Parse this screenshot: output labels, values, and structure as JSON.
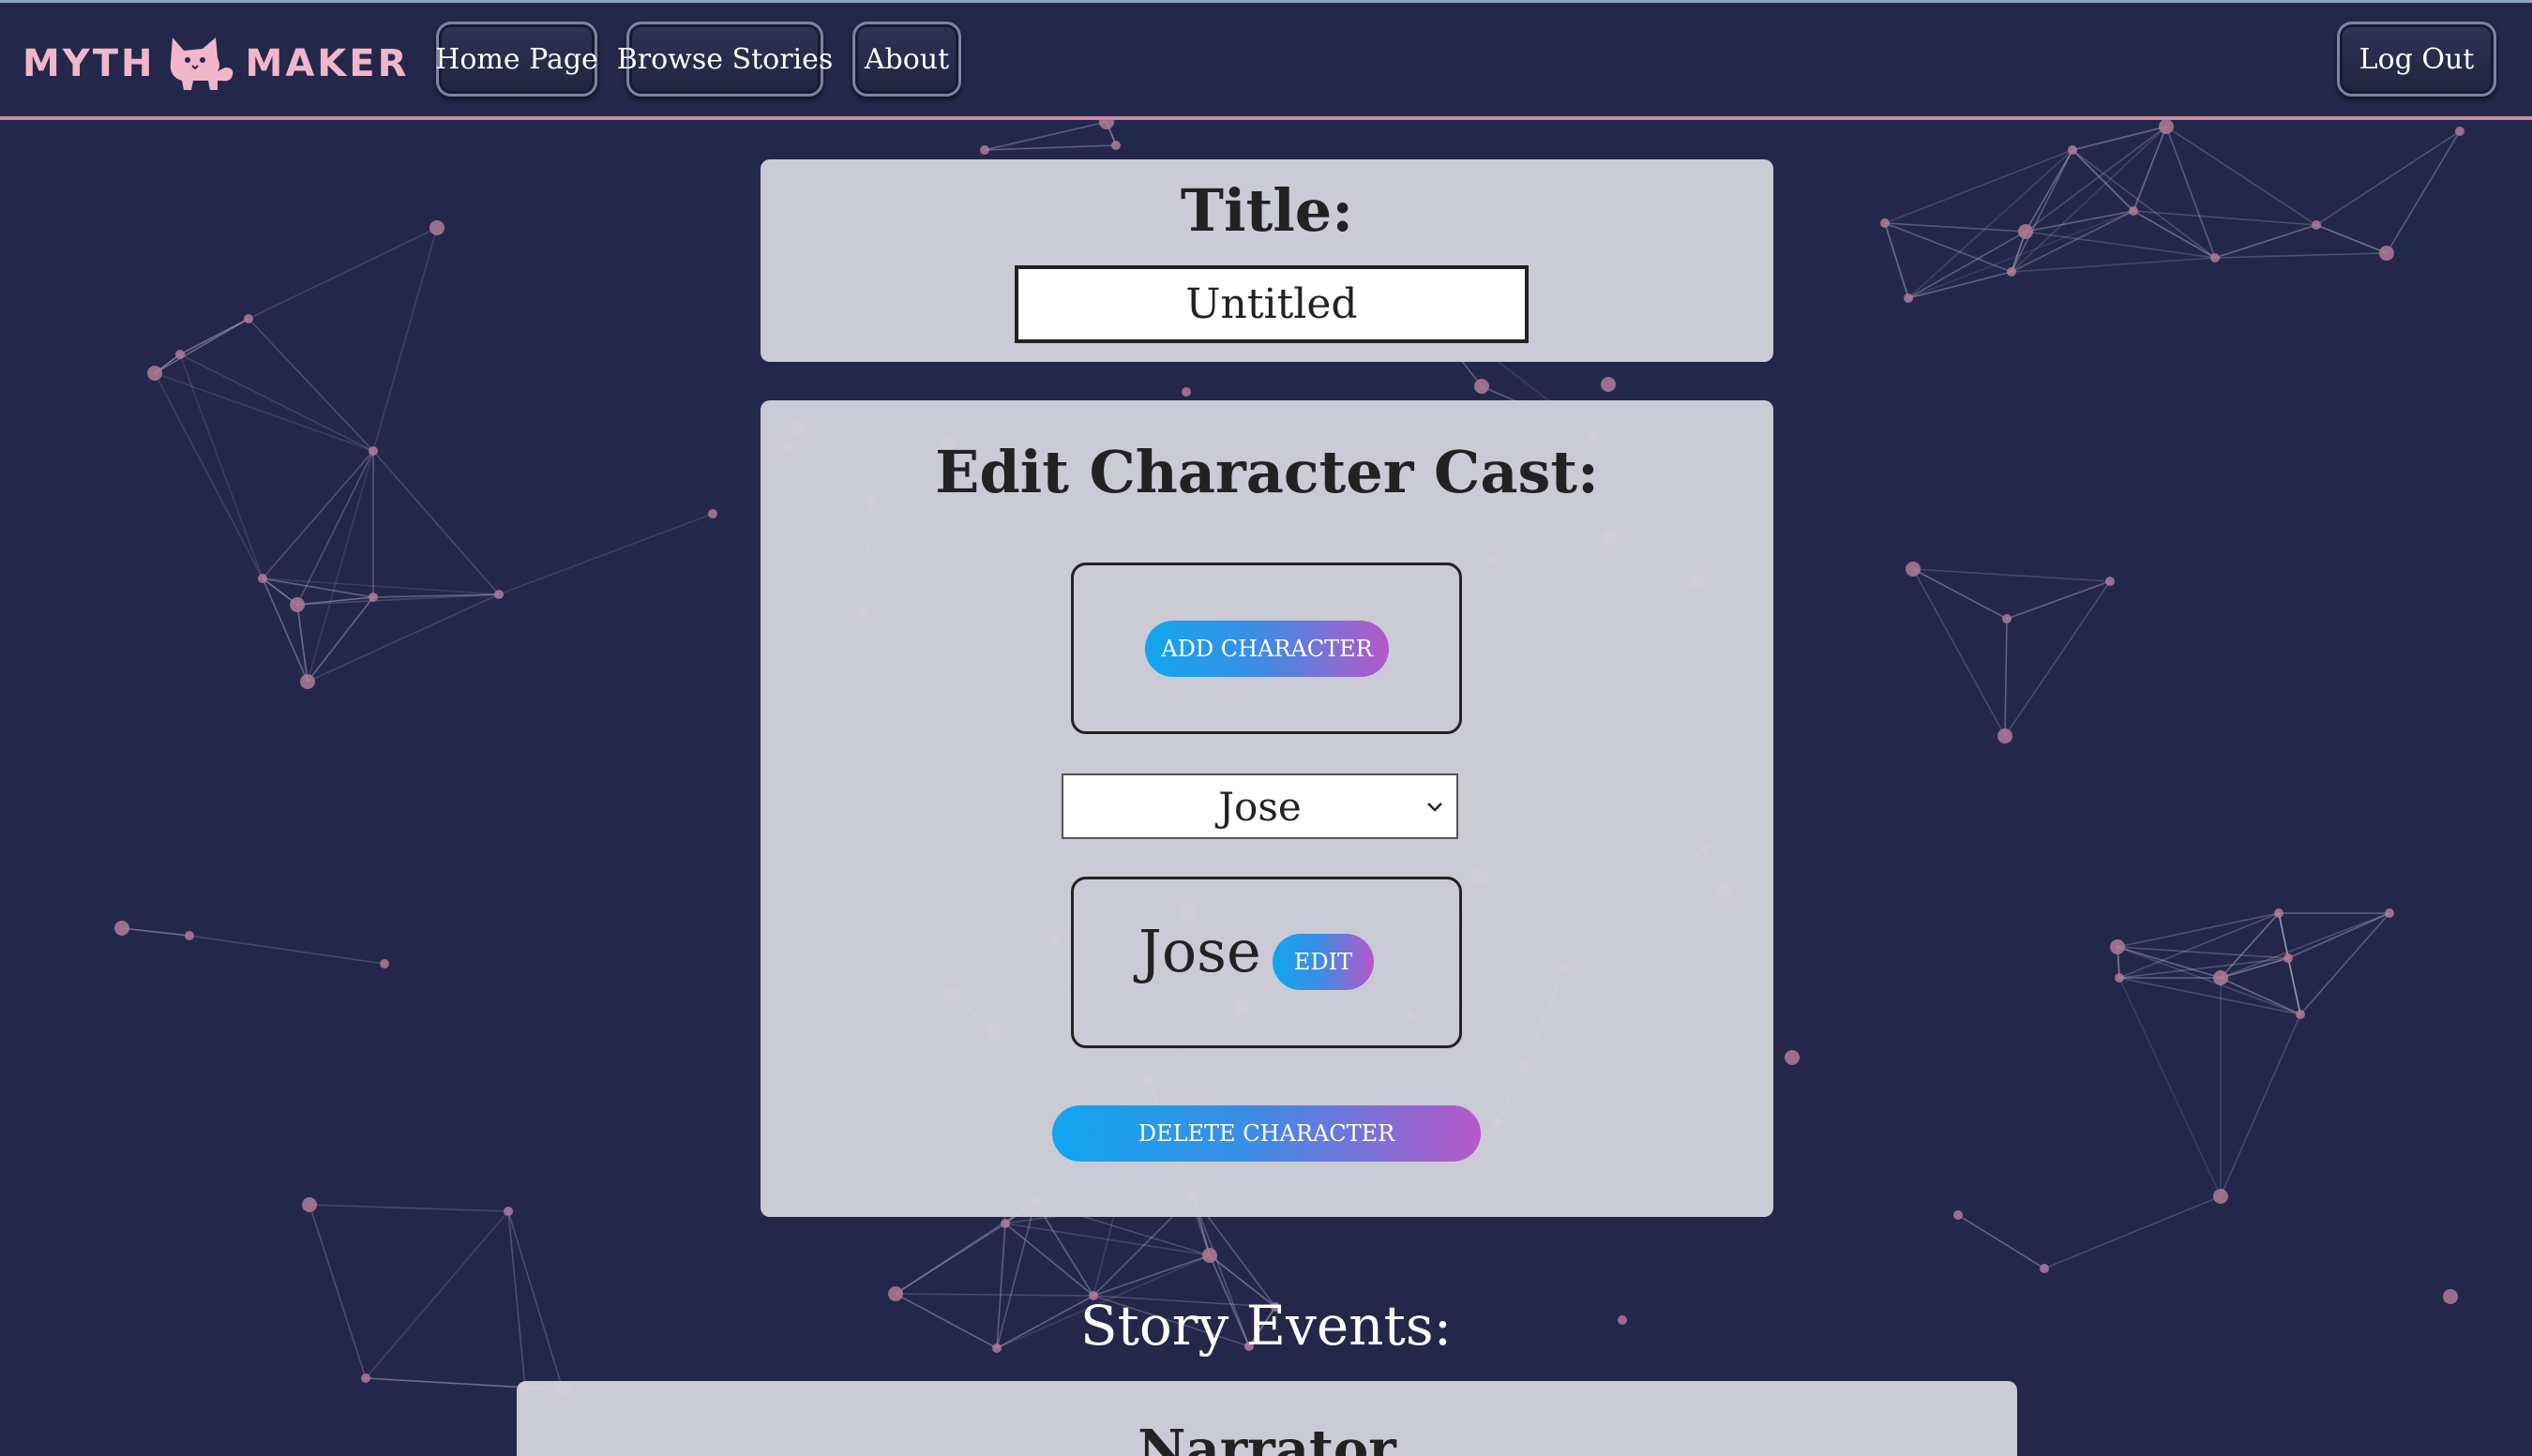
{
  "app": {
    "logo_left": "MYTH",
    "logo_right": "MAKER",
    "logo_icon": "cat-icon"
  },
  "nav": {
    "home": "Home Page",
    "browse": "Browse Stories",
    "about": "About",
    "logout": "Log Out"
  },
  "title_panel": {
    "heading": "Title:",
    "value": "Untitled"
  },
  "cast_panel": {
    "heading": "Edit Character Cast:",
    "add_button": "ADD CHARACTER",
    "selected_character": "Jose",
    "character_options": [
      "Jose"
    ],
    "character_name": "Jose",
    "edit_button": "EDIT",
    "delete_button": "DELETE CHARACTER"
  },
  "story_events": {
    "heading": "Story Events:",
    "first_event_speaker": "Narrator"
  },
  "colors": {
    "background": "#23284a",
    "panel": "#d1d2da",
    "logo_pink": "#f1b6c9",
    "gradient_start": "#10a6ee",
    "gradient_end": "#b558c8",
    "network_node": "#b07a96"
  }
}
